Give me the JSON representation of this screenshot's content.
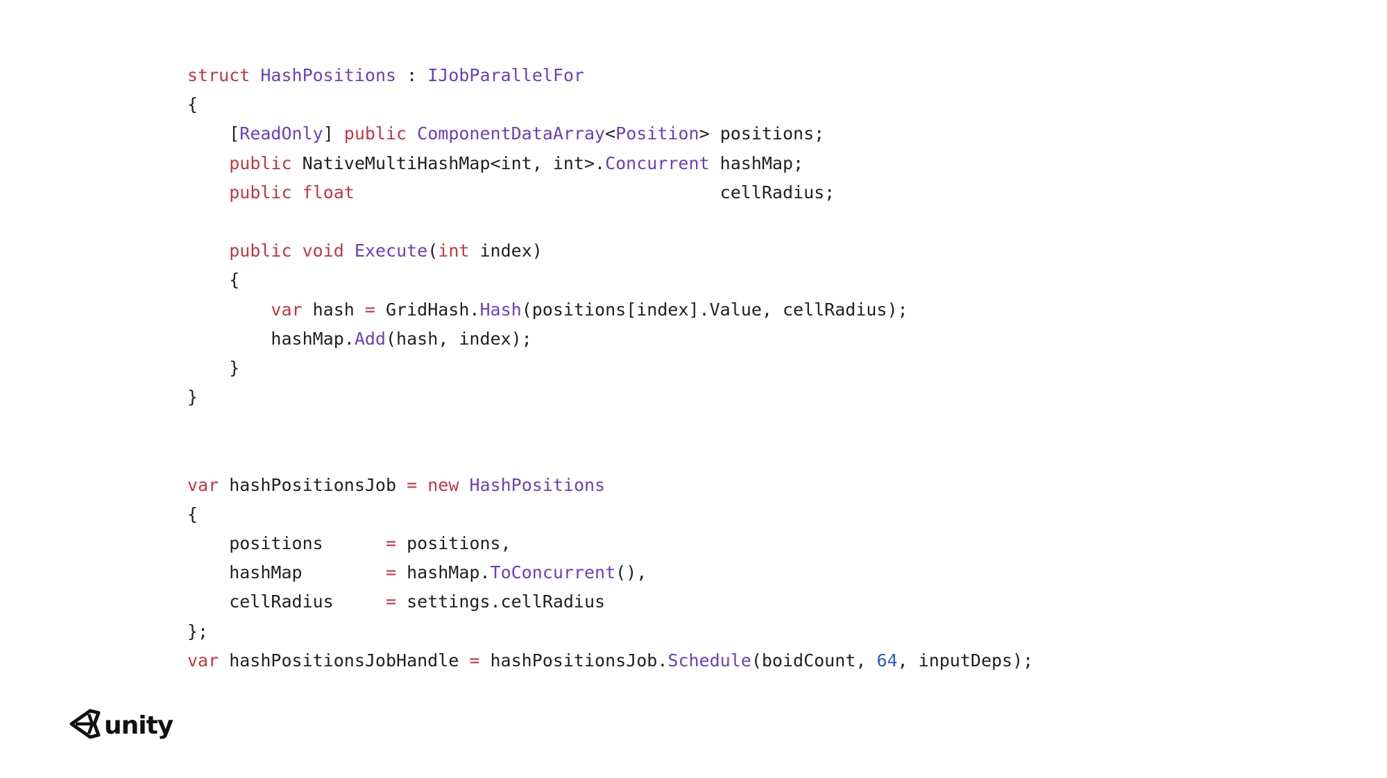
{
  "code_lines": [
    [
      {
        "t": "struct",
        "c": "kw"
      },
      {
        "t": " "
      },
      {
        "t": "HashPositions",
        "c": "ty"
      },
      {
        "t": " : "
      },
      {
        "t": "IJobParallelFor",
        "c": "ty"
      }
    ],
    [
      {
        "t": "{"
      }
    ],
    [
      {
        "t": "    ["
      },
      {
        "t": "ReadOnly",
        "c": "ty"
      },
      {
        "t": "] "
      },
      {
        "t": "public",
        "c": "kw"
      },
      {
        "t": " "
      },
      {
        "t": "ComponentDataArray",
        "c": "ty"
      },
      {
        "t": "<"
      },
      {
        "t": "Position",
        "c": "ty"
      },
      {
        "t": "> positions;"
      }
    ],
    [
      {
        "t": "    "
      },
      {
        "t": "public",
        "c": "kw"
      },
      {
        "t": " NativeMultiHashMap<int, int>."
      },
      {
        "t": "Concurrent",
        "c": "ty"
      },
      {
        "t": " hashMap;"
      }
    ],
    [
      {
        "t": "    "
      },
      {
        "t": "public",
        "c": "kw"
      },
      {
        "t": " "
      },
      {
        "t": "float",
        "c": "kw"
      },
      {
        "t": "                                   cellRadius;"
      }
    ],
    [
      {
        "t": ""
      }
    ],
    [
      {
        "t": "    "
      },
      {
        "t": "public",
        "c": "kw"
      },
      {
        "t": " "
      },
      {
        "t": "void",
        "c": "kw"
      },
      {
        "t": " "
      },
      {
        "t": "Execute",
        "c": "ty"
      },
      {
        "t": "("
      },
      {
        "t": "int",
        "c": "kw"
      },
      {
        "t": " index)"
      }
    ],
    [
      {
        "t": "    {"
      }
    ],
    [
      {
        "t": "        "
      },
      {
        "t": "var",
        "c": "kw"
      },
      {
        "t": " hash "
      },
      {
        "t": "=",
        "c": "kw"
      },
      {
        "t": " GridHash."
      },
      {
        "t": "Hash",
        "c": "ty"
      },
      {
        "t": "(positions[index].Value, cellRadius);"
      }
    ],
    [
      {
        "t": "        hashMap."
      },
      {
        "t": "Add",
        "c": "ty"
      },
      {
        "t": "(hash, index);"
      }
    ],
    [
      {
        "t": "    }"
      }
    ],
    [
      {
        "t": "}"
      }
    ],
    [
      {
        "t": ""
      }
    ],
    [
      {
        "t": ""
      }
    ],
    [
      {
        "t": "var",
        "c": "kw"
      },
      {
        "t": " hashPositionsJob "
      },
      {
        "t": "=",
        "c": "kw"
      },
      {
        "t": " "
      },
      {
        "t": "new",
        "c": "kw"
      },
      {
        "t": " "
      },
      {
        "t": "HashPositions",
        "c": "ty"
      }
    ],
    [
      {
        "t": "{"
      }
    ],
    [
      {
        "t": "    positions      "
      },
      {
        "t": "=",
        "c": "kw"
      },
      {
        "t": " positions,"
      }
    ],
    [
      {
        "t": "    hashMap        "
      },
      {
        "t": "=",
        "c": "kw"
      },
      {
        "t": " hashMap."
      },
      {
        "t": "ToConcurrent",
        "c": "ty"
      },
      {
        "t": "(),"
      }
    ],
    [
      {
        "t": "    cellRadius     "
      },
      {
        "t": "=",
        "c": "kw"
      },
      {
        "t": " settings.cellRadius"
      }
    ],
    [
      {
        "t": "};"
      }
    ],
    [
      {
        "t": "var",
        "c": "kw"
      },
      {
        "t": " hashPositionsJobHandle "
      },
      {
        "t": "=",
        "c": "kw"
      },
      {
        "t": " hashPositionsJob."
      },
      {
        "t": "Schedule",
        "c": "ty"
      },
      {
        "t": "(boidCount, "
      },
      {
        "t": "64",
        "c": "num"
      },
      {
        "t": ", inputDeps);"
      }
    ]
  ],
  "colors": {
    "keyword": "#c8343f",
    "type": "#6a3fc4",
    "number": "#1d5fc9",
    "text": "#1f1f1f"
  },
  "logo": {
    "icon": "unity-cube-icon",
    "text": "unity"
  }
}
